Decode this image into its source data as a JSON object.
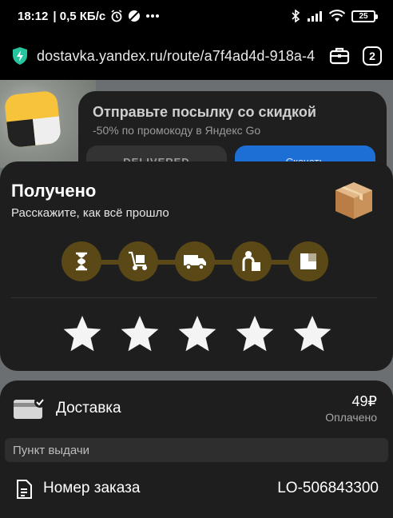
{
  "status_bar": {
    "time": "18:12",
    "network_speed": "| 0,5 КБ/с",
    "battery": "25",
    "icons": [
      "alarm-icon",
      "no-disturb-icon",
      "more-dots-icon",
      "bluetooth-icon",
      "signal-icon",
      "wifi-icon",
      "battery-icon"
    ]
  },
  "browser": {
    "url": "dostavka.yandex.ru/route/a7f4ad4d-918a-4",
    "tabs_count": "2",
    "accent": "#27c4a0"
  },
  "background_page": {
    "promo_title": "Отправьте посылку со скидкой",
    "promo_sub": "-50% по промокоду в Яндекс Go",
    "promo_button_left": "DELIVERED",
    "promo_button_right": "Скачать"
  },
  "order_status": {
    "title": "Получено",
    "subtitle": "Расскажите, как всё прошло",
    "steps": [
      "hourglass-icon",
      "hand-truck-icon",
      "delivery-truck-icon",
      "person-with-box-icon",
      "box-icon"
    ],
    "rating_max": 5,
    "step_color": "#5a4816",
    "icon_color": "#ffffff"
  },
  "delivery": {
    "label": "Доставка",
    "price": "49₽",
    "paid": "Оплачено",
    "pickup_point": "Пункт выдачи",
    "order_label": "Номер заказа",
    "order_number": "LO-506843300"
  }
}
